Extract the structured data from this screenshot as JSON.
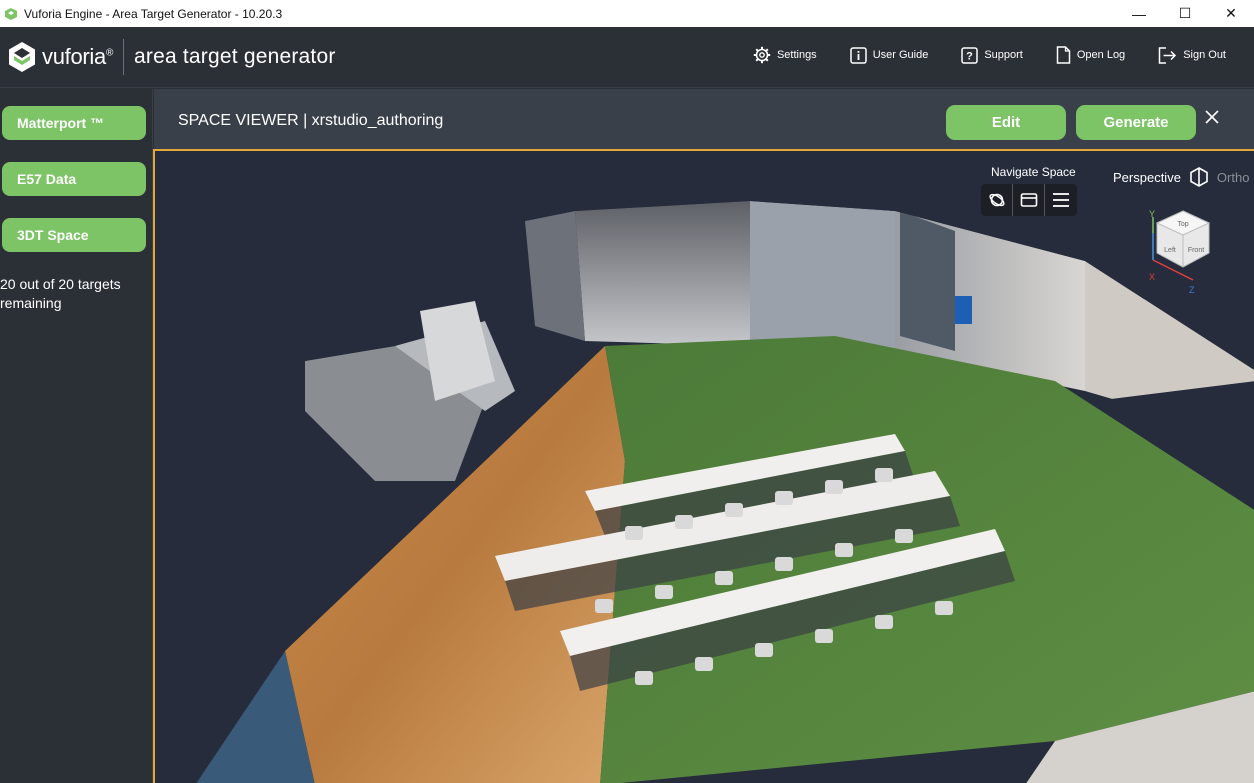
{
  "window": {
    "title": "Vuforia Engine - Area Target Generator - 10.20.3",
    "minimize_glyph": "—",
    "maximize_glyph": "☐",
    "close_glyph": "✕"
  },
  "header": {
    "brand": "vuforia",
    "brand_mark": "®",
    "product": "area target generator",
    "links": [
      {
        "label": "Settings",
        "icon": "gear-icon"
      },
      {
        "label": "User Guide",
        "icon": "info-icon"
      },
      {
        "label": "Support",
        "icon": "help-icon"
      },
      {
        "label": "Open Log",
        "icon": "document-icon"
      },
      {
        "label": "Sign Out",
        "icon": "sign-out-icon"
      }
    ]
  },
  "sidebar": {
    "buttons": [
      {
        "label": "Matterport ™"
      },
      {
        "label": "E57 Data"
      },
      {
        "label": "3DT Space"
      }
    ],
    "status_text": "20 out of 20 targets remaining"
  },
  "viewer": {
    "title": "SPACE VIEWER | xrstudio_authoring",
    "edit_label": "Edit",
    "generate_label": "Generate",
    "close_glyph": "✕",
    "navigate_label": "Navigate Space",
    "perspective_label": "Perspective",
    "ortho_label": "Ortho",
    "cube": {
      "top": "Top",
      "left": "Left",
      "front": "Front",
      "axis_y": "Y",
      "axis_x": "X",
      "axis_z": "Z"
    }
  },
  "colors": {
    "accent_green": "#7dc466",
    "viewport_border": "#e2a93a",
    "header_bg": "#2b2f36",
    "viewer_bar_bg": "#3a4049",
    "viewport_bg": "#262c3b"
  }
}
